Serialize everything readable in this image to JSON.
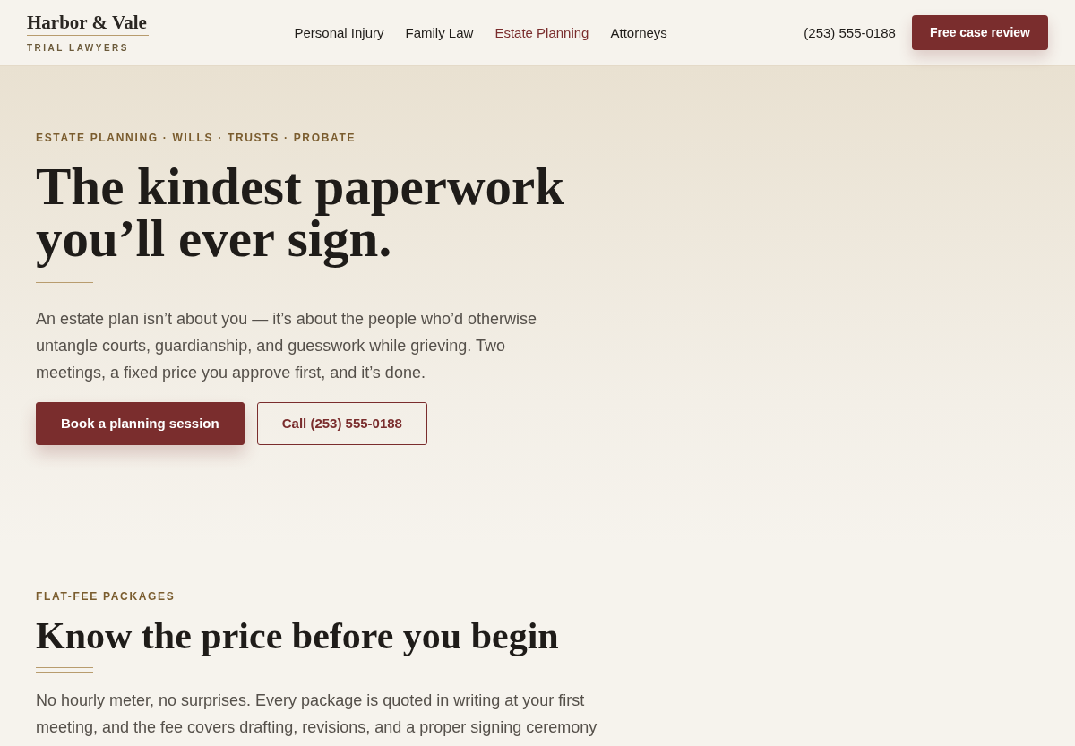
{
  "header": {
    "logo": {
      "name": "Harbor & Vale",
      "tagline": "TRIAL LAWYERS"
    },
    "nav": [
      {
        "label": "Personal Injury",
        "selected": false
      },
      {
        "label": "Family Law",
        "selected": false
      },
      {
        "label": "Estate Planning",
        "selected": true
      },
      {
        "label": "Attorneys",
        "selected": false
      }
    ],
    "phone": "(253) 555-0188",
    "cta": "Free case review"
  },
  "hero": {
    "eyebrow": "ESTATE PLANNING · WILLS · TRUSTS · PROBATE",
    "title": "The kindest paperwork you’ll ever sign.",
    "body": "An estate plan isn’t about you — it’s about the people who’d otherwise untangle courts, guardianship, and guesswork while grieving. Two meetings, a fixed price you approve first, and it’s done.",
    "buttons": [
      {
        "label": "Book a planning session",
        "kind": "primary"
      },
      {
        "label": "Call (253) 555-0188",
        "kind": "outline"
      }
    ]
  },
  "packages": {
    "eyebrow": "FLAT-FEE PACKAGES",
    "title": "Know the price before you begin",
    "body": "No hourly meter, no surprises. Every package is quoted in writing at your first meeting, and the fee covers drafting, revisions, and a proper signing ceremony"
  }
}
